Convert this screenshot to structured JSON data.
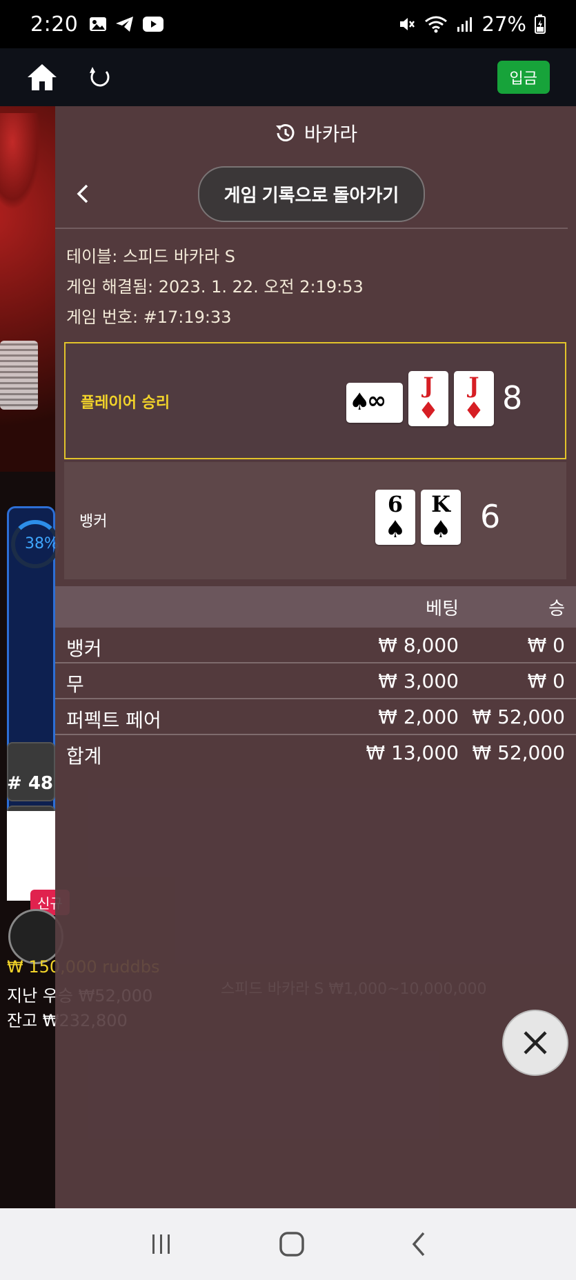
{
  "status_bar": {
    "time": "2:20",
    "battery": "27%",
    "left_icons": [
      "gallery-icon",
      "telegram-icon",
      "youtube-icon"
    ],
    "right_icons": [
      "mute-icon",
      "wifi-icon",
      "signal-icon",
      "battery-icon"
    ]
  },
  "app_bar": {
    "deposit_label": "입금",
    "deposit_color": "#17a33a"
  },
  "background": {
    "percent": "38%",
    "round": "# 48",
    "new_badge": "신규",
    "balance_lines": [
      "₩ 150,000 ruddbs",
      "지난 우승 ₩52,000",
      "잔고 ₩232,800"
    ],
    "table_limits": "스피드 바카라 S ₩1,000~10,000,000"
  },
  "overlay": {
    "title": "바카라",
    "back_button": "게임 기록으로 돌아가기",
    "info": {
      "table": "테이블: 스피드 바카라 S",
      "resolved": "게임 해결됨: 2023. 1. 22. 오전 2:19:53",
      "game_number": "게임 번호: #17:19:33"
    },
    "player": {
      "label": "플레이어 승리",
      "score": "8",
      "cards": [
        {
          "rank": "∞",
          "suit": "♠",
          "sideways": true,
          "color": "black"
        },
        {
          "rank": "J",
          "suit": "♦",
          "sideways": false,
          "color": "red"
        },
        {
          "rank": "J",
          "suit": "♦",
          "sideways": false,
          "color": "red"
        }
      ]
    },
    "banker": {
      "label": "뱅커",
      "score": "6",
      "cards": [
        {
          "rank": "6",
          "suit": "♠",
          "sideways": false,
          "color": "black"
        },
        {
          "rank": "K",
          "suit": "♠",
          "sideways": false,
          "color": "black"
        }
      ]
    },
    "bets": {
      "header_bet": "베팅",
      "header_win": "승",
      "rows": [
        {
          "name": "뱅커",
          "bet": "₩ 8,000",
          "win": "₩ 0"
        },
        {
          "name": "무",
          "bet": "₩ 3,000",
          "win": "₩ 0"
        },
        {
          "name": "퍼펙트 페어",
          "bet": "₩ 2,000",
          "win": "₩ 52,000"
        }
      ],
      "total": {
        "name": "합계",
        "bet": "₩ 13,000",
        "win": "₩ 52,000"
      }
    },
    "win_color": "#f2d42a"
  },
  "android_nav": {
    "icons": [
      "recents-icon",
      "home-circle-icon",
      "back-icon"
    ]
  }
}
